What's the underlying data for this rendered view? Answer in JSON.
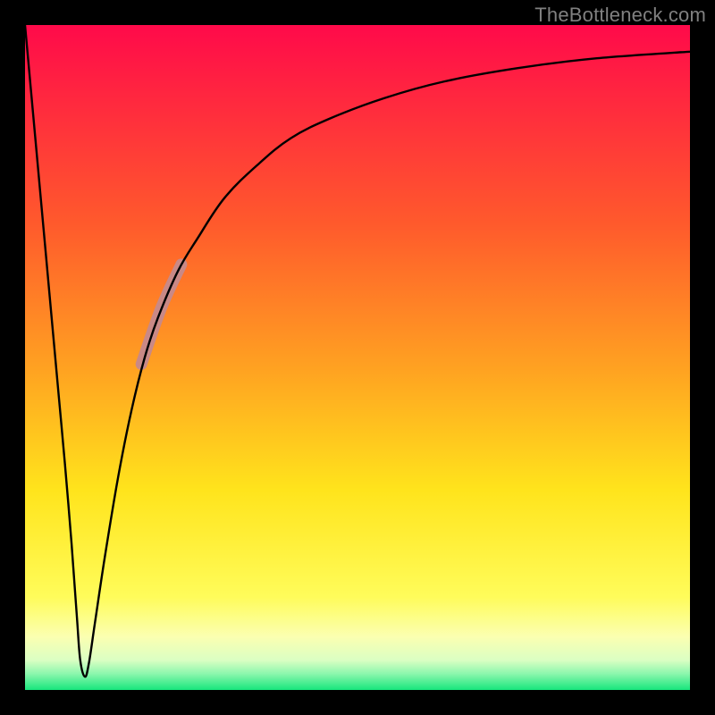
{
  "watermark": "TheBottleneck.com",
  "colors": {
    "frame": "#000000",
    "watermark": "#808080",
    "curve": "#000000",
    "highlight": "#c98986"
  },
  "chart_data": {
    "type": "line",
    "title": "",
    "xlabel": "",
    "ylabel": "",
    "xlim": [
      0,
      100
    ],
    "ylim": [
      0,
      100
    ],
    "grid": false,
    "gradient_stops": [
      {
        "pos": 0.0,
        "color": "#ff0a4a"
      },
      {
        "pos": 0.3,
        "color": "#ff5a2c"
      },
      {
        "pos": 0.52,
        "color": "#ffa321"
      },
      {
        "pos": 0.7,
        "color": "#ffe41c"
      },
      {
        "pos": 0.86,
        "color": "#fffc5a"
      },
      {
        "pos": 0.92,
        "color": "#fbffb1"
      },
      {
        "pos": 0.955,
        "color": "#dbffc3"
      },
      {
        "pos": 0.975,
        "color": "#8ef7ae"
      },
      {
        "pos": 1.0,
        "color": "#17e67c"
      }
    ],
    "series": [
      {
        "name": "left-branch",
        "x": [
          0,
          1,
          2,
          3,
          4,
          5,
          6,
          7,
          7.8,
          8.3,
          9
        ],
        "y": [
          100,
          89,
          78,
          67,
          56,
          45,
          34,
          22,
          11,
          4.5,
          2
        ]
      },
      {
        "name": "right-branch",
        "x": [
          9,
          9.6,
          10.5,
          12,
          14,
          16,
          18,
          20,
          23,
          26,
          30,
          35,
          40,
          46,
          54,
          63,
          74,
          86,
          100
        ],
        "y": [
          2,
          4,
          10,
          20,
          32,
          42,
          50,
          56,
          63,
          68,
          74,
          79,
          83,
          86,
          89,
          91.5,
          93.5,
          95,
          96
        ]
      }
    ],
    "highlight_segment": {
      "series": "right-branch",
      "x_start": 17.5,
      "x_end": 23.5,
      "y_start": 49,
      "y_end": 64,
      "stroke_width_px": 13
    }
  }
}
